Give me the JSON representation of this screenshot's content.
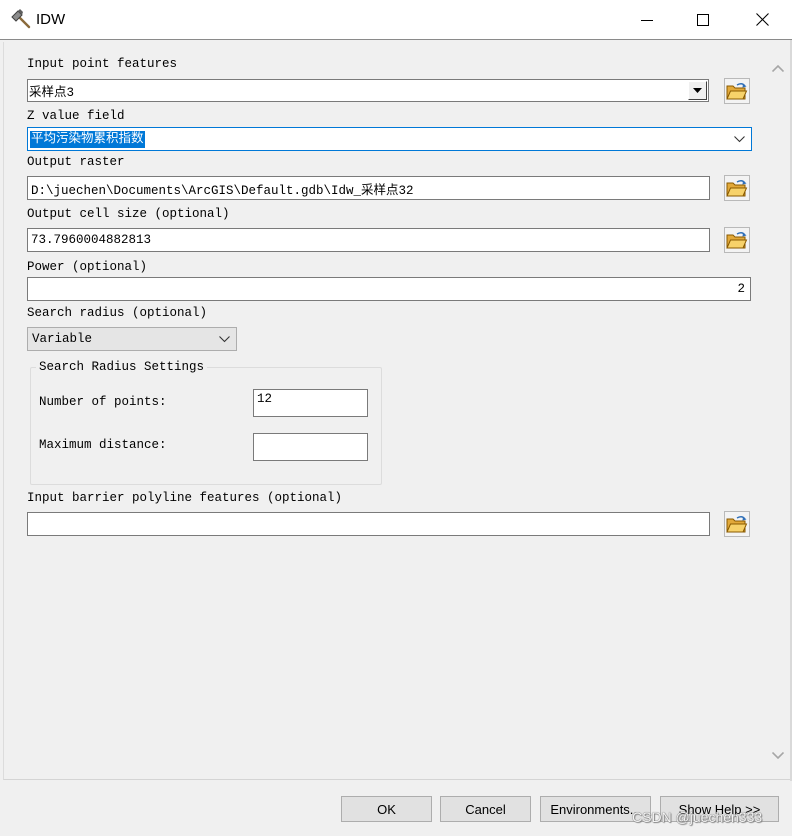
{
  "window": {
    "title": "IDW",
    "icons": {
      "app": "hammer-icon",
      "minimize": "minimize-icon",
      "maximize": "maximize-icon",
      "close": "close-icon"
    }
  },
  "params": {
    "input_point_features": {
      "label": "Input point features",
      "value": "采样点3"
    },
    "z_value_field": {
      "label": "Z value field",
      "value": "平均污染物累积指数"
    },
    "output_raster": {
      "label": "Output raster",
      "value": "D:\\juechen\\Documents\\ArcGIS\\Default.gdb\\Idw_采样点32"
    },
    "output_cell_size": {
      "label": "Output cell size (optional)",
      "value": "73.7960004882813"
    },
    "power": {
      "label": "Power (optional)",
      "value": "2"
    },
    "search_radius": {
      "label": "Search radius (optional)",
      "value": "Variable"
    },
    "search_radius_settings": {
      "legend": "Search Radius Settings",
      "number_of_points": {
        "label": "Number of points:",
        "value": "12"
      },
      "maximum_distance": {
        "label": "Maximum distance:",
        "value": ""
      }
    },
    "input_barrier_polyline_features": {
      "label": "Input barrier polyline features (optional)",
      "value": ""
    }
  },
  "buttons": {
    "ok": "OK",
    "cancel": "Cancel",
    "environments": "Environments...",
    "show_help": "Show Help >>"
  },
  "watermark": "CSDN @juechen333",
  "icons": {
    "browse": "open-folder-icon",
    "combo_dropdown": "dropdown-arrow-icon",
    "select_dropdown": "chevron-down-icon",
    "scroll_up": "chevron-up-icon",
    "scroll_down": "chevron-down-icon"
  },
  "colors": {
    "selection": "#0078d7",
    "dialog_background": "#f0f0f0",
    "input_border": "#7a7a7a",
    "button_face": "#e1e1e1",
    "button_border": "#adadad",
    "folder": "#f2c14e"
  }
}
